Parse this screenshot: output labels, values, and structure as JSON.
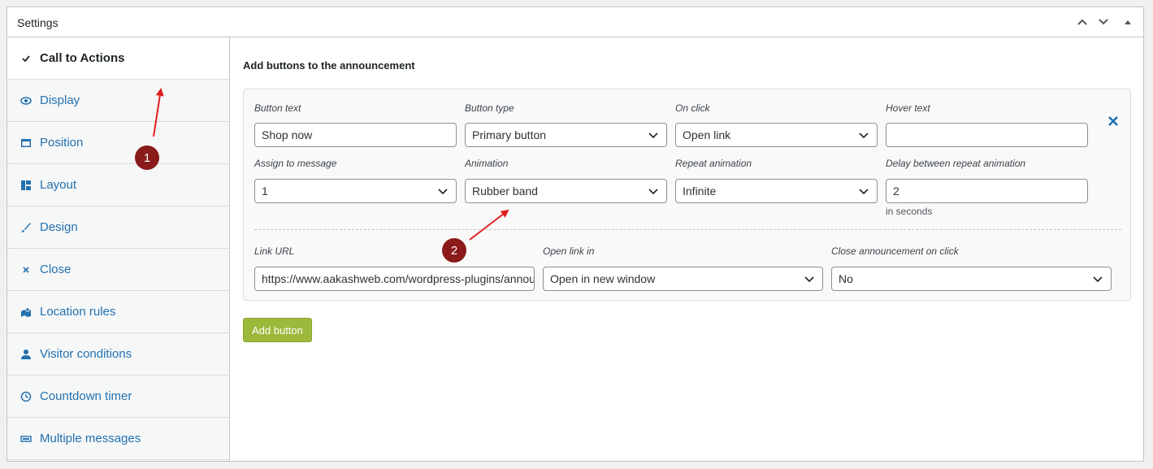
{
  "panel": {
    "title": "Settings"
  },
  "header_controls": [
    "chevron-up-icon",
    "chevron-down-icon",
    "triangle-up-icon"
  ],
  "tabs": [
    {
      "label": "Call to Actions",
      "icon": "check-icon",
      "active": true
    },
    {
      "label": "Display",
      "icon": "eye-icon"
    },
    {
      "label": "Position",
      "icon": "position-icon"
    },
    {
      "label": "Layout",
      "icon": "layout-icon"
    },
    {
      "label": "Design",
      "icon": "brush-icon"
    },
    {
      "label": "Close",
      "icon": "close-icon"
    },
    {
      "label": "Location rules",
      "icon": "location-icon"
    },
    {
      "label": "Visitor conditions",
      "icon": "user-icon"
    },
    {
      "label": "Countdown timer",
      "icon": "clock-icon"
    },
    {
      "label": "Multiple messages",
      "icon": "messages-icon"
    }
  ],
  "content": {
    "title": "Add buttons to the announcement",
    "button_row": {
      "button_text": {
        "label": "Button text",
        "value": "Shop now"
      },
      "button_type": {
        "label": "Button type",
        "value": "Primary button"
      },
      "on_click": {
        "label": "On click",
        "value": "Open link"
      },
      "hover_text": {
        "label": "Hover text",
        "value": ""
      },
      "assign_to_message": {
        "label": "Assign to message",
        "value": "1"
      },
      "animation": {
        "label": "Animation",
        "value": "Rubber band"
      },
      "repeat_animation": {
        "label": "Repeat animation",
        "value": "Infinite"
      },
      "delay": {
        "label": "Delay between repeat animation",
        "value": "2",
        "hint": "in seconds"
      },
      "link_url": {
        "label": "Link URL",
        "value": "https://www.aakashweb.com/wordpress-plugins/announcer/"
      },
      "open_link_in": {
        "label": "Open link in",
        "value": "Open in new window"
      },
      "close_on_click": {
        "label": "Close announcement on click",
        "value": "No"
      },
      "remove_icon": "close-x-icon"
    },
    "add_button_label": "Add button"
  },
  "annotations": [
    {
      "label": "1"
    },
    {
      "label": "2"
    }
  ],
  "colors": {
    "link_blue": "#2271b1",
    "add_button_green": "#9cb93b",
    "annotation_red": "#e02020",
    "badge_dark_red": "#8b1a1a"
  }
}
